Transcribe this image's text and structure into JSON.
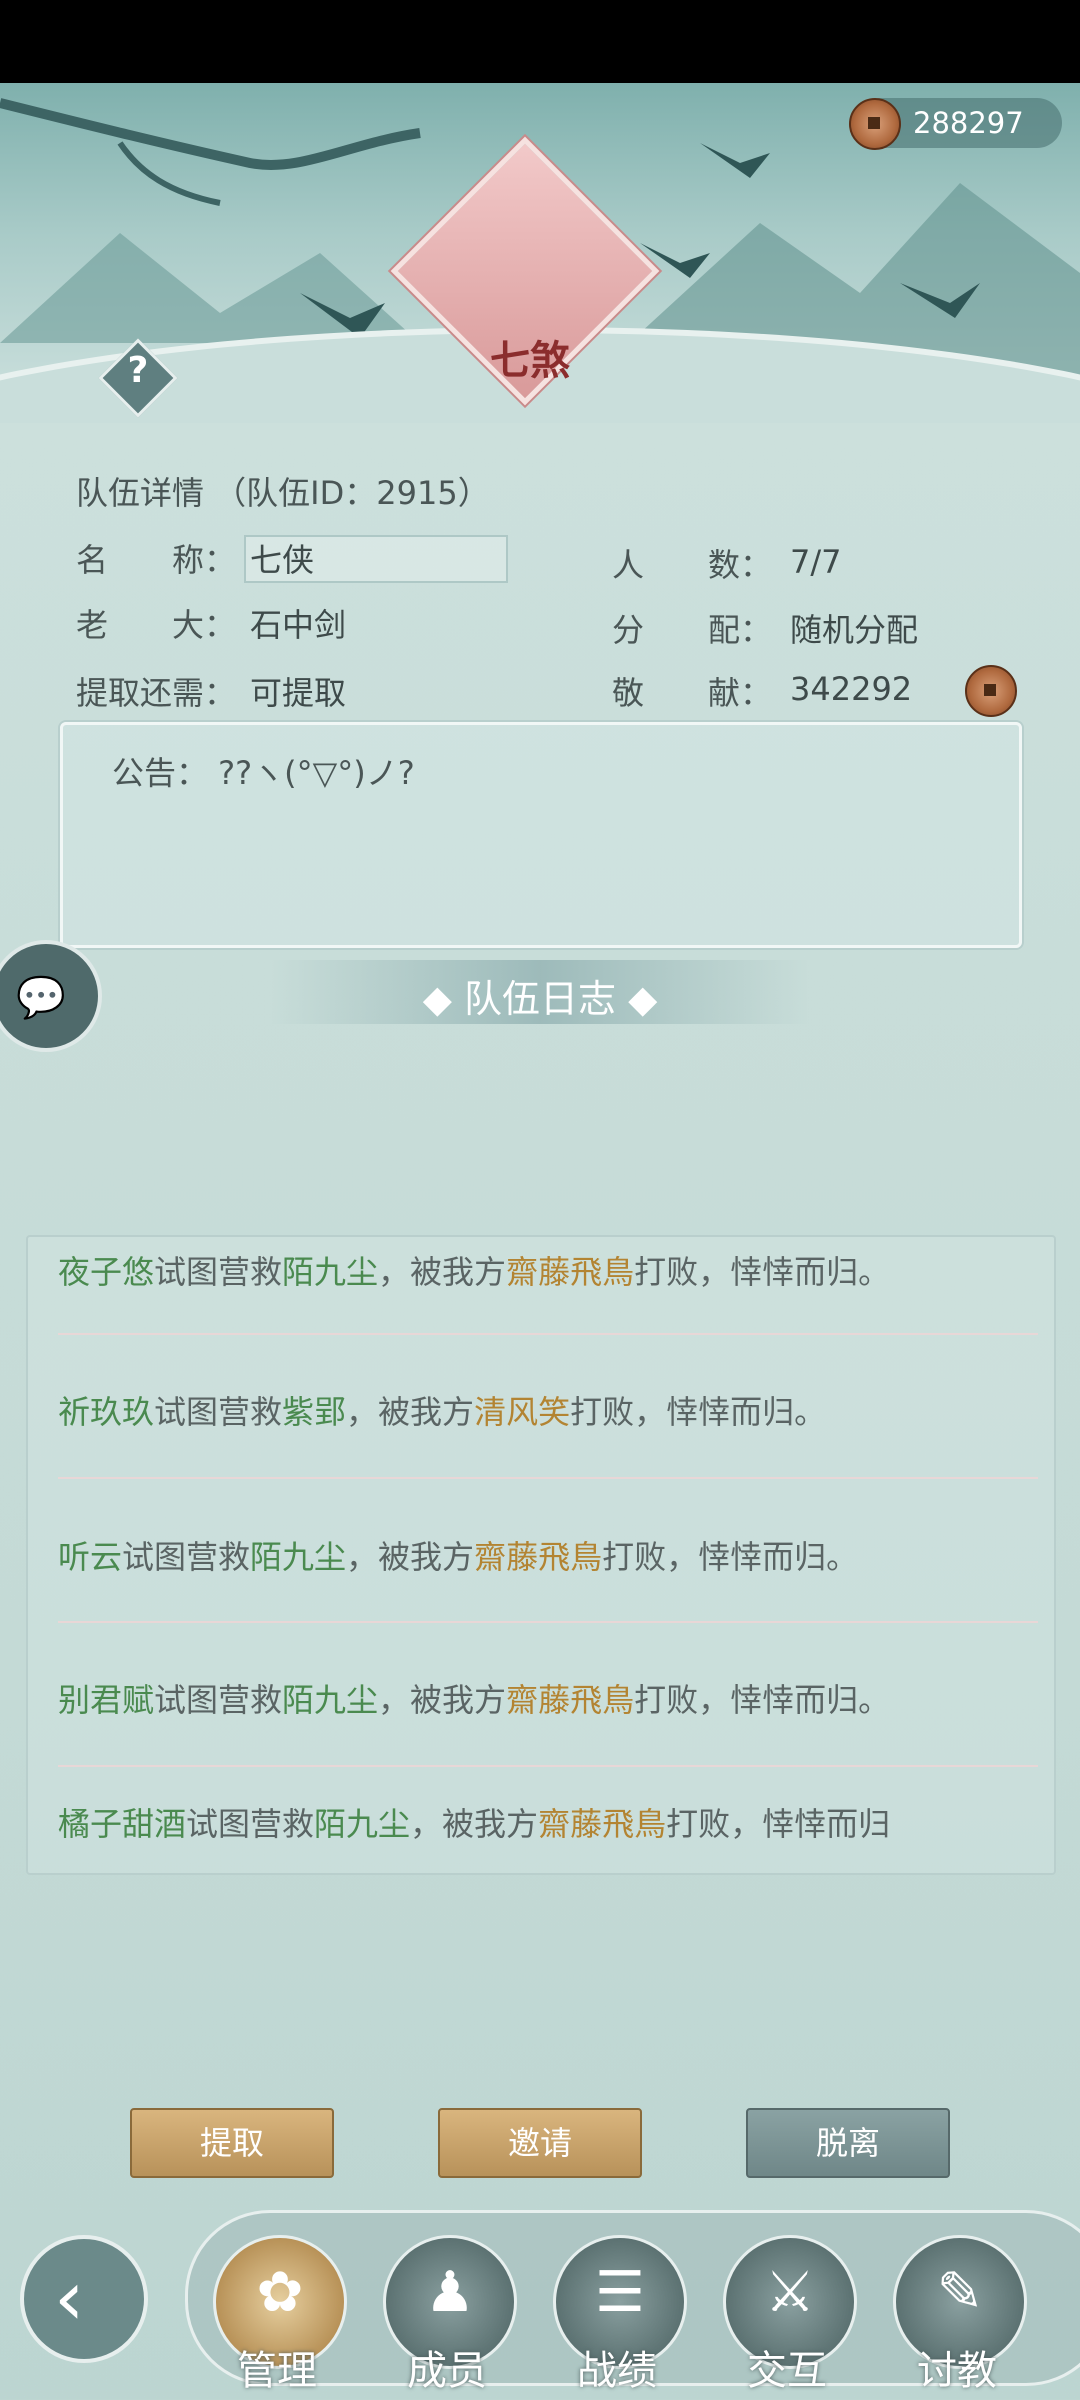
{
  "currency": {
    "amount": "288297",
    "icon": "copper-coin-icon"
  },
  "emblem": {
    "name": "七煞"
  },
  "team": {
    "title": "队伍详情 （队伍ID：2915）",
    "name_label": "名　　称：",
    "name_value": "七侠",
    "members_label": "人　　数：",
    "members_value": "7/7",
    "leader_label": "老　　大：",
    "leader_value": "石中剑",
    "alloc_label": "分　　配：",
    "alloc_value": "随机分配",
    "withdraw_label": "提取还需：",
    "withdraw_value": "可提取",
    "contrib_label": "敬　　献：",
    "contrib_value": "342292"
  },
  "notice": {
    "text": "公告： ??ヽ(°▽°)ノ?"
  },
  "log_section": {
    "title": "◆ 队伍日志 ◆"
  },
  "logs": [
    {
      "a": "夜子悠",
      "m1": "试图营救",
      "b": "陌九尘",
      "m2": "，被我方",
      "c": "齋藤飛鳥",
      "m3": "打败，悻悻而归。"
    },
    {
      "a": "祈玖玖",
      "m1": "试图营救",
      "b": "紫郢",
      "m2": "，被我方",
      "c": "清风笑",
      "m3": "打败，悻悻而归。"
    },
    {
      "a": "听云",
      "m1": "试图营救",
      "b": "陌九尘",
      "m2": "，被我方",
      "c": "齋藤飛鳥",
      "m3": "打败，悻悻而归。"
    },
    {
      "a": "别君赋",
      "m1": "试图营救",
      "b": "陌九尘",
      "m2": "，被我方",
      "c": "齋藤飛鳥",
      "m3": "打败，悻悻而归。"
    },
    {
      "a": "橘子甜酒",
      "m1": "试图营救",
      "b": "陌九尘",
      "m2": "，被我方",
      "c": "齋藤飛鳥",
      "m3": "打败，悻悻而归"
    }
  ],
  "buttons": {
    "withdraw": "提取",
    "invite": "邀请",
    "leave": "脱离"
  },
  "nav": [
    {
      "label": "管理",
      "icon": "manage-icon",
      "glyph": "✿"
    },
    {
      "label": "成员",
      "icon": "members-icon",
      "glyph": "♟"
    },
    {
      "label": "战绩",
      "icon": "record-icon",
      "glyph": "☰"
    },
    {
      "label": "交互",
      "icon": "interact-icon",
      "glyph": "⚔"
    },
    {
      "label": "讨教",
      "icon": "challenge-icon",
      "glyph": "✎"
    }
  ],
  "colors": {
    "name_green": "#4a8a4f",
    "name_orange": "#b38432",
    "gold_button": "#c8a46b",
    "gray_button": "#7d9596"
  }
}
